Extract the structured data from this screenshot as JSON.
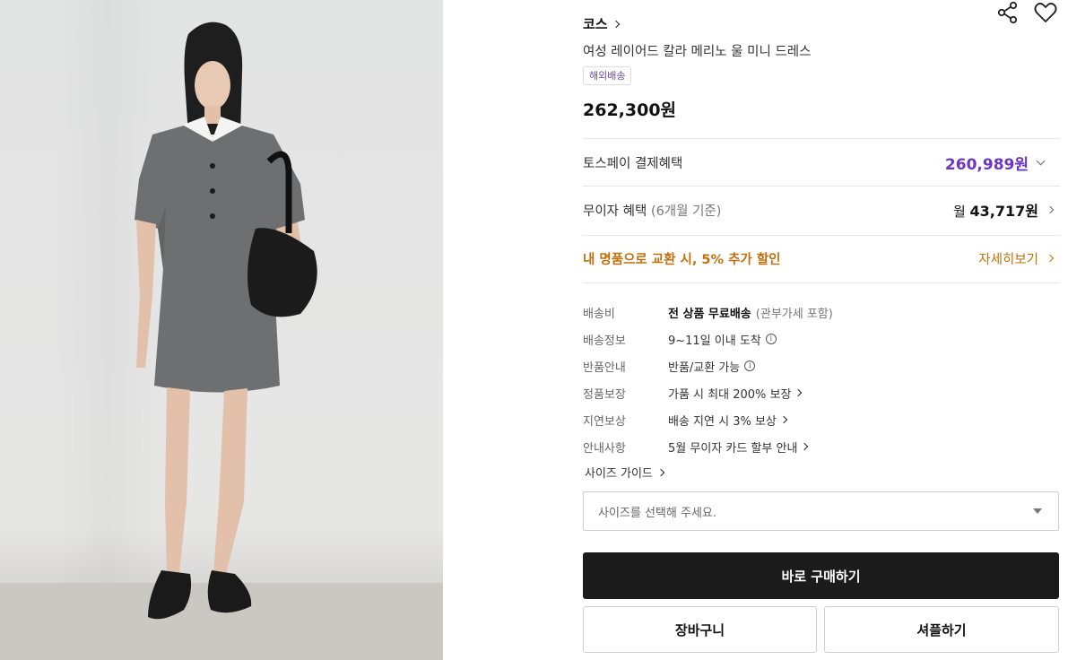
{
  "product": {
    "brand": "코스",
    "title": "여성 레이어드 칼라 메리노 울 미니 드레스",
    "badge": "해외배송",
    "price": "262,300원"
  },
  "icons": {
    "share": "share-icon",
    "wishlist": "heart-icon"
  },
  "benefits": {
    "tosspay_label": "토스페이 결제혜택",
    "tosspay_price": "260,989원",
    "installment_label": "무이자 혜택",
    "installment_sub": "(6개월 기준)",
    "installment_prefix": "월",
    "installment_price": "43,717원",
    "promo_text": "내 명품으로 교환 시, 5% 추가 할인",
    "promo_link": "자세히보기"
  },
  "shipping": {
    "rows": [
      {
        "key": "배송비",
        "value": "전 상품 무료배송",
        "extra": "(관부가세 포함)"
      },
      {
        "key": "배송정보",
        "value": "9~11일 이내 도착"
      },
      {
        "key": "반품안내",
        "value": "반품/교환 가능"
      },
      {
        "key": "정품보장",
        "value": "가품 시 최대 200% 보장"
      },
      {
        "key": "지연보상",
        "value": "배송 지연 시 3% 보상"
      },
      {
        "key": "안내사항",
        "value": "5월 무이자 카드 할부 안내"
      }
    ]
  },
  "size_guide": "사이즈 가이드",
  "size_select": {
    "placeholder": "사이즈를 선택해 주세요."
  },
  "buttons": {
    "buy_now": "바로 구매하기",
    "cart": "장바구니",
    "share": "셔플하기"
  },
  "colors": {
    "accent_purple": "#6e34c8",
    "promo_orange": "#c2700d",
    "primary_button": "#1b1b1b"
  }
}
